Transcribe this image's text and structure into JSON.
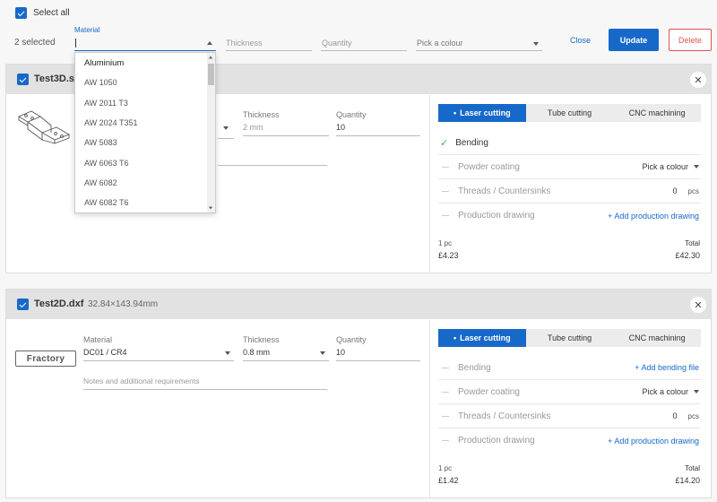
{
  "toolbar": {
    "select_all": "Select all",
    "selected_count": "2 selected",
    "material_label": "Material",
    "thickness_placeholder": "Thickness",
    "quantity_placeholder": "Quantity",
    "colour_placeholder": "Pick a colour",
    "close": "Close",
    "update": "Update",
    "delete": "Delete"
  },
  "dropdown": {
    "items": [
      "Aluminium",
      "AW 1050",
      "AW 2011 T3",
      "AW 2024 T351",
      "AW 5083",
      "AW 6063 T6",
      "AW 6082",
      "AW 6082 T6"
    ]
  },
  "parts": [
    {
      "filename": "Test3D.stp",
      "thickness_label": "Thickness",
      "thickness_value": "2 mm",
      "quantity_label": "Quantity",
      "quantity_value": "10",
      "tabs": [
        "Laser cutting",
        "Tube cutting",
        "CNC machining"
      ],
      "bending": "Bending",
      "powder": "Powder coating",
      "pick_colour": "Pick a colour",
      "threads": "Threads / Countersinks",
      "threads_value": "0",
      "threads_unit": "pcs",
      "drawing": "Production drawing",
      "add_drawing": "+ Add production drawing",
      "unit_label": "1 pc",
      "unit_price": "£4.23",
      "total_label": "Total",
      "total_price": "£42.30"
    },
    {
      "filename": "Test2D.dxf",
      "dims": "32.84×143.94mm",
      "logo_text": "Fractory",
      "material_label": "Material",
      "material_value": "DC01 / CR4",
      "thickness_label": "Thickness",
      "thickness_value": "0.8 mm",
      "quantity_label": "Quantity",
      "quantity_value": "10",
      "notes_placeholder": "Notes and additional requirements",
      "tabs": [
        "Laser cutting",
        "Tube cutting",
        "CNC machining"
      ],
      "bending": "Bending",
      "add_bending": "+ Add bending file",
      "powder": "Powder coating",
      "pick_colour": "Pick a colour",
      "threads": "Threads / Countersinks",
      "threads_value": "0",
      "threads_unit": "pcs",
      "drawing": "Production drawing",
      "add_drawing": "+ Add production drawing",
      "unit_label": "1 pc",
      "unit_price": "£1.42",
      "total_label": "Total",
      "total_price": "£14.20"
    }
  ],
  "colors": {
    "accent": "#1769c9",
    "danger": "#e05252",
    "success": "#4caf50"
  }
}
